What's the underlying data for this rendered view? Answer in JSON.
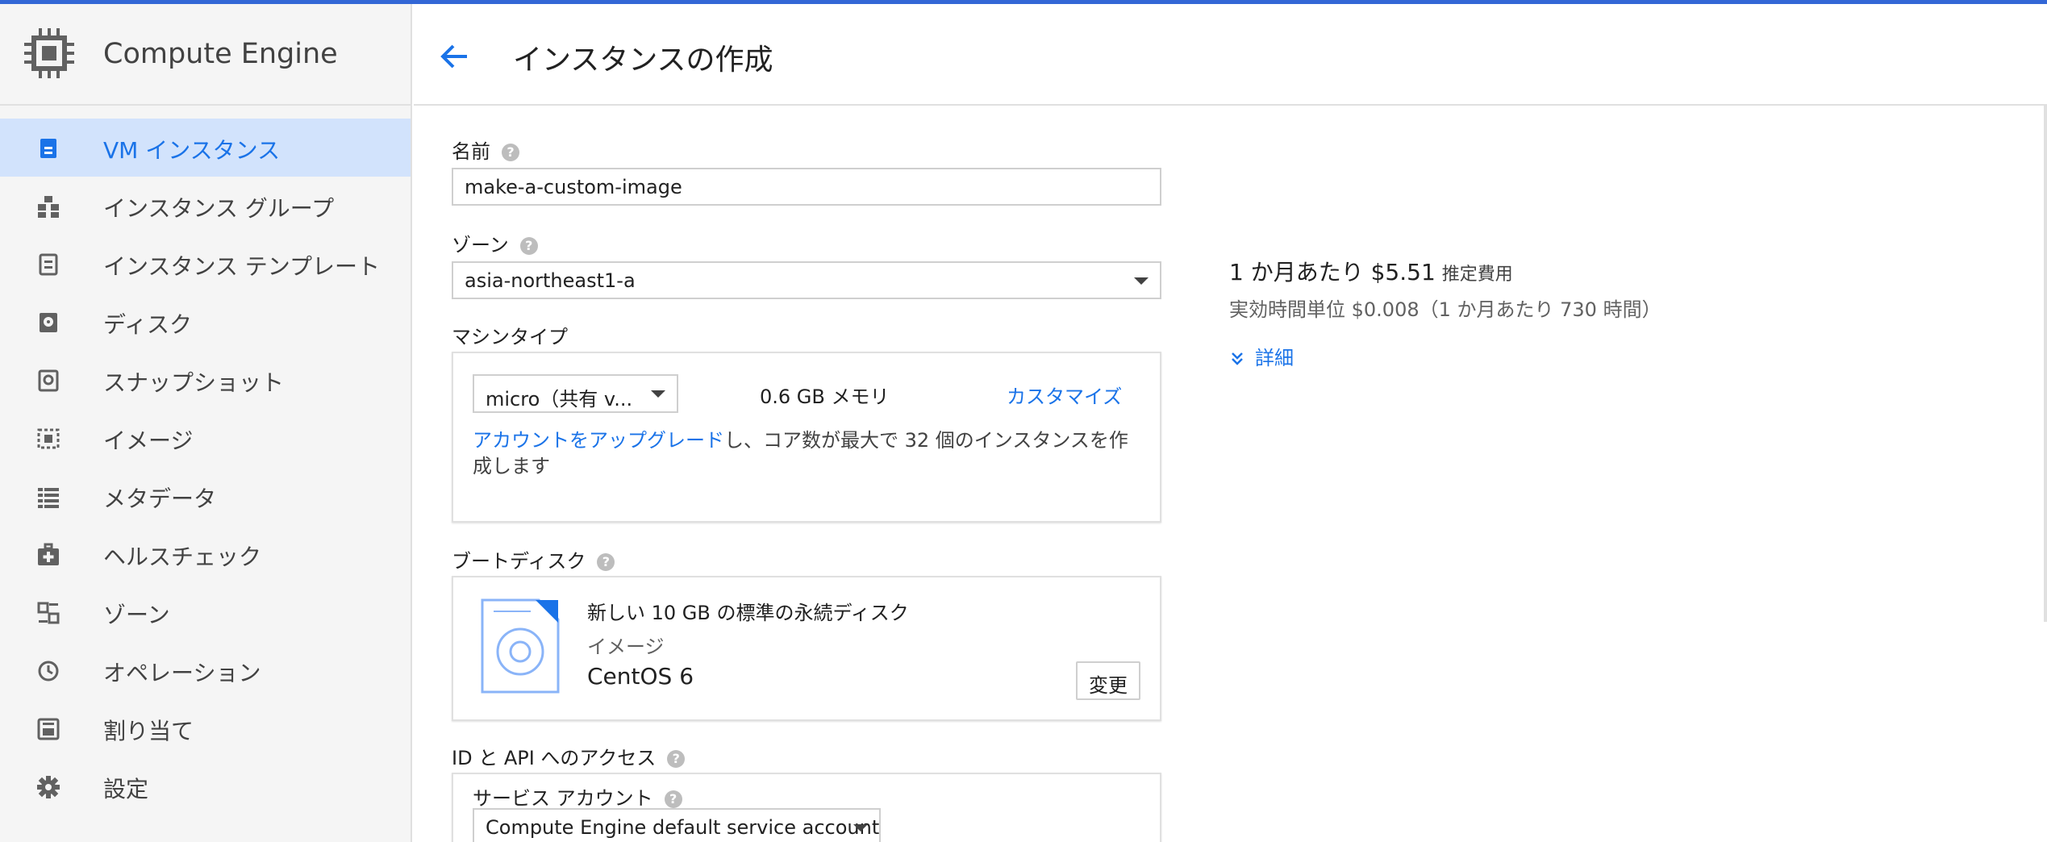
{
  "colors": {
    "accent": "#1a73e8",
    "active_bg": "#d2e3fc",
    "topline": "#3367d6"
  },
  "app": {
    "title": "Compute Engine",
    "icon": "chip-icon"
  },
  "sidebar": {
    "items": [
      {
        "label": "VM インスタンス",
        "icon": "vm-instance-icon",
        "active": true
      },
      {
        "label": "インスタンス グループ",
        "icon": "instance-group-icon"
      },
      {
        "label": "インスタンス テンプレート",
        "icon": "instance-template-icon"
      },
      {
        "label": "ディスク",
        "icon": "disk-icon"
      },
      {
        "label": "スナップショット",
        "icon": "snapshot-icon"
      },
      {
        "label": "イメージ",
        "icon": "image-icon"
      },
      {
        "label": "メタデータ",
        "icon": "metadata-icon"
      },
      {
        "label": "ヘルスチェック",
        "icon": "health-check-icon"
      },
      {
        "label": "ゾーン",
        "icon": "zone-icon"
      },
      {
        "label": "オペレーション",
        "icon": "operation-icon"
      },
      {
        "label": "割り当て",
        "icon": "quota-icon"
      },
      {
        "label": "設定",
        "icon": "settings-icon"
      }
    ]
  },
  "header": {
    "title": "インスタンスの作成",
    "back_icon": "back-arrow-icon"
  },
  "form": {
    "name": {
      "label": "名前",
      "help": "?",
      "value": "make-a-custom-image"
    },
    "zone": {
      "label": "ゾーン",
      "help": "?",
      "value": "asia-northeast1-a"
    },
    "machine_type": {
      "label": "マシンタイプ",
      "select_value": "micro（共有 v...",
      "memory": "0.6 GB メモリ",
      "customize": "カスタマイズ",
      "upgrade_link": "アカウントをアップグレード",
      "upgrade_text_1": "し、コア数が最大で 32 個のインスタンスを作",
      "upgrade_text_2": "成します"
    },
    "boot_disk": {
      "label": "ブートディスク",
      "help": "?",
      "title": "新しい 10 GB の標準の永続ディスク",
      "image_label": "イメージ",
      "image_value": "CentOS 6",
      "change_button": "変更"
    },
    "access": {
      "label": "ID と API へのアクセス",
      "help": "?",
      "service_account_label": "サービス アカウント",
      "service_account_help": "?",
      "service_account_value": "Compute Engine default service account"
    }
  },
  "pricing": {
    "main": "1 か月あたり $5.51",
    "tag": "推定費用",
    "sub": "実効時間単位 $0.008（1 か月あたり 730 時間）",
    "details": "詳細"
  }
}
